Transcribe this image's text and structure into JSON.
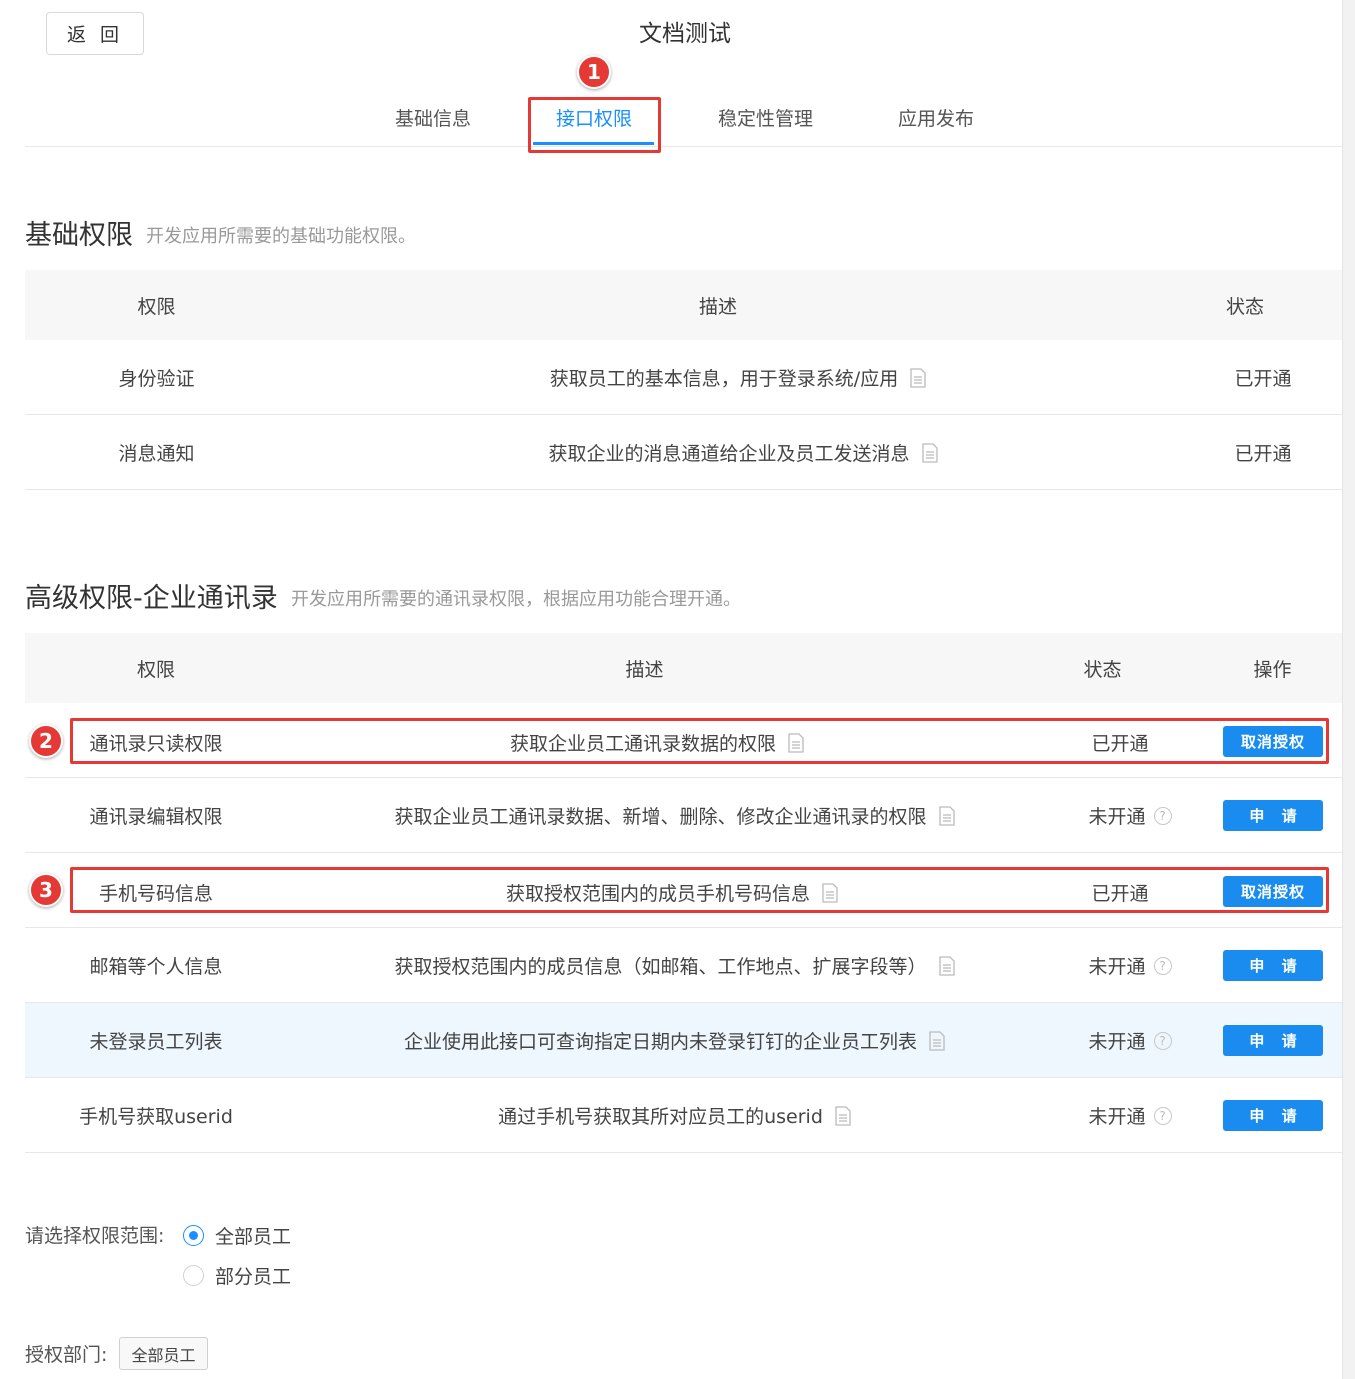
{
  "header": {
    "back_label": "返 回",
    "title": "文档测试"
  },
  "tabs": [
    {
      "label": "基础信息",
      "active": false
    },
    {
      "label": "接口权限",
      "active": true
    },
    {
      "label": "稳定性管理",
      "active": false
    },
    {
      "label": "应用发布",
      "active": false
    }
  ],
  "markers": [
    "1",
    "2",
    "3"
  ],
  "basic": {
    "title": "基础权限",
    "subtitle": "开发应用所需要的基础功能权限。",
    "headers": {
      "perm": "权限",
      "desc": "描述",
      "status": "状态"
    },
    "rows": [
      {
        "perm": "身份验证",
        "desc": "获取员工的基本信息，用于登录系统/应用",
        "status": "已开通"
      },
      {
        "perm": "消息通知",
        "desc": "获取企业的消息通道给企业及员工发送消息",
        "status": "已开通"
      }
    ]
  },
  "advanced": {
    "title": "高级权限-企业通讯录",
    "subtitle": "开发应用所需要的通讯录权限，根据应用功能合理开通。",
    "headers": {
      "perm": "权限",
      "desc": "描述",
      "status": "状态",
      "action": "操作"
    },
    "rows": [
      {
        "perm": "通讯录只读权限",
        "desc": "获取企业员工通讯录数据的权限",
        "status": "已开通",
        "action": "取消授权"
      },
      {
        "perm": "通讯录编辑权限",
        "desc": "获取企业员工通讯录数据、新增、删除、修改企业通讯录的权限",
        "status": "未开通",
        "action": "申 请"
      },
      {
        "perm": "手机号码信息",
        "desc": "获取授权范围内的成员手机号码信息",
        "status": "已开通",
        "action": "取消授权"
      },
      {
        "perm": "邮箱等个人信息",
        "desc": "获取授权范围内的成员信息（如邮箱、工作地点、扩展字段等）",
        "status": "未开通",
        "action": "申 请"
      },
      {
        "perm": "未登录员工列表",
        "desc": "企业使用此接口可查询指定日期内未登录钉钉的企业员工列表",
        "status": "未开通",
        "action": "申 请"
      },
      {
        "perm": "手机号获取userid",
        "desc": "通过手机号获取其所对应员工的userid",
        "status": "未开通",
        "action": "申 请"
      }
    ]
  },
  "scope": {
    "label": "请选择权限范围:",
    "options": [
      {
        "label": "全部员工",
        "checked": true
      },
      {
        "label": "部分员工",
        "checked": false
      }
    ]
  },
  "dept": {
    "label": "授权部门:",
    "tag": "全部员工"
  },
  "colors": {
    "accent": "#1890ff",
    "button": "#1a8cf0",
    "highlight": "#e53935"
  }
}
